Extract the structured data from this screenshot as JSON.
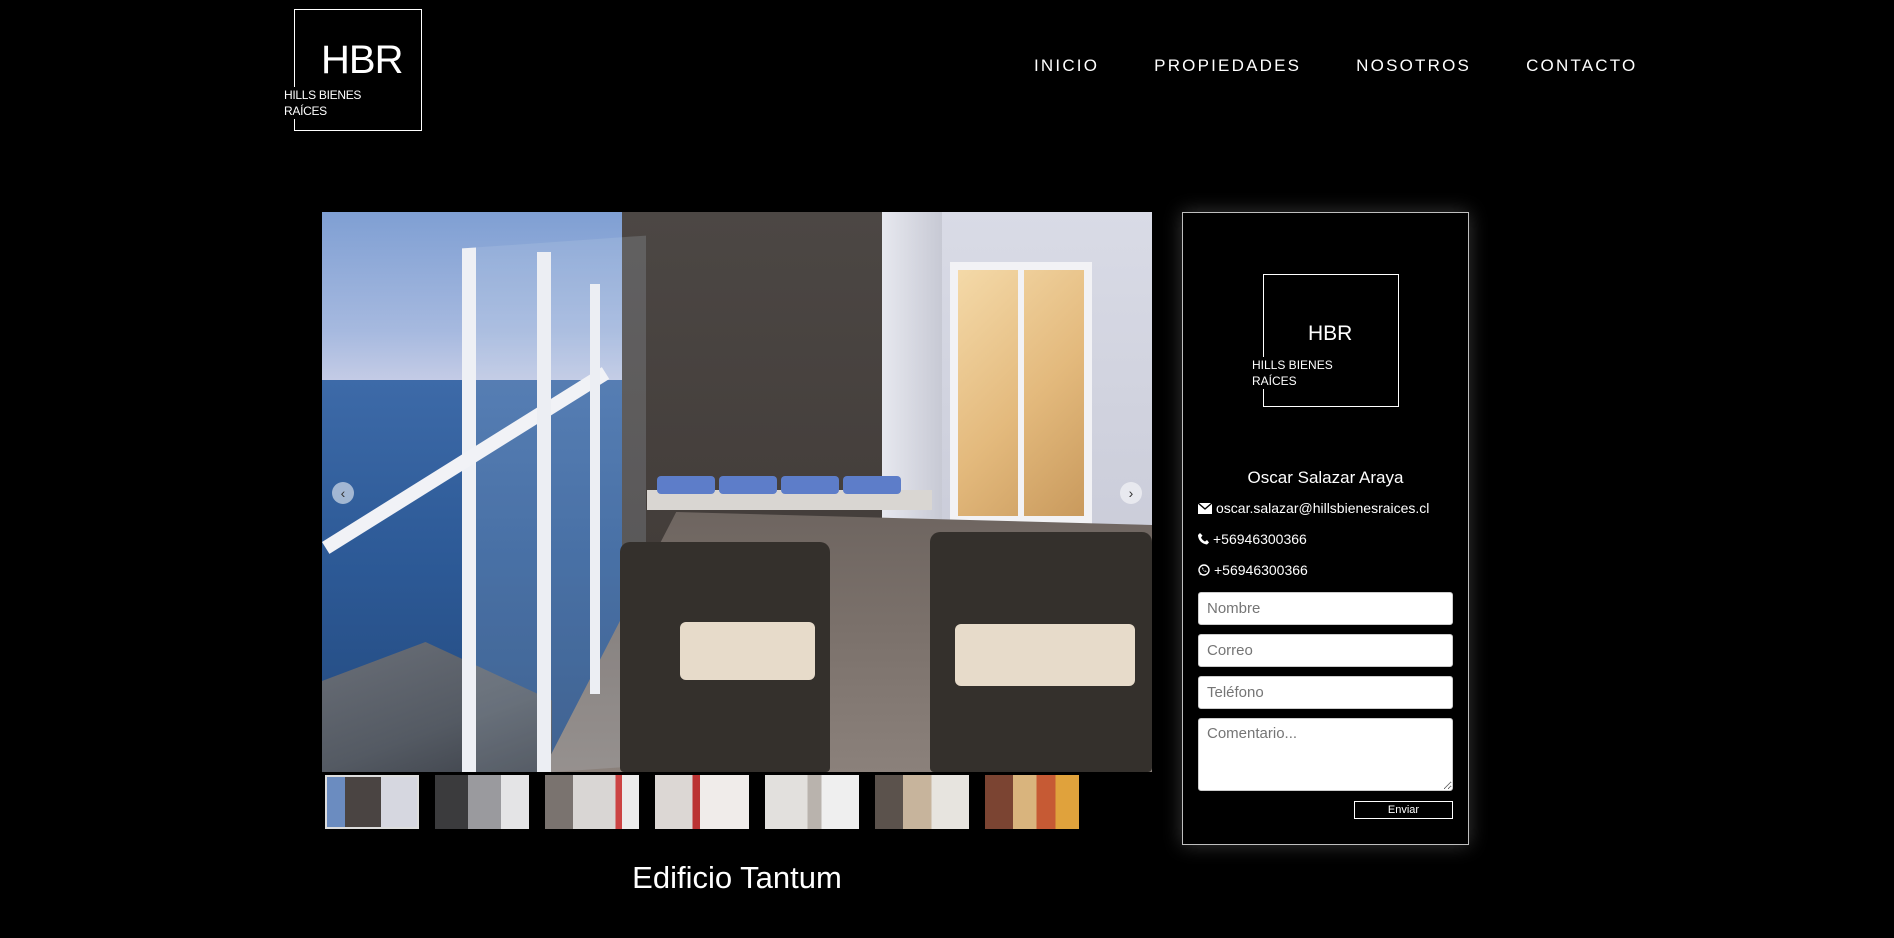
{
  "header": {
    "logo": {
      "mark": "HBR",
      "line1": "HILLS BIENES",
      "line2": "RAÍCES"
    },
    "nav": [
      {
        "label": "INICIO"
      },
      {
        "label": "PROPIEDADES"
      },
      {
        "label": "NOSOTROS"
      },
      {
        "label": "CONTACTO"
      }
    ]
  },
  "gallery": {
    "prev_icon": "chevron-left-icon",
    "next_icon": "chevron-right-icon",
    "thumbnails": [
      {
        "alt": "balcony",
        "color": "#6b7c9c"
      },
      {
        "alt": "living-room",
        "color": "#8a8a8e"
      },
      {
        "alt": "kitchen",
        "color": "#a7a2a0"
      },
      {
        "alt": "bedroom",
        "color": "#c9c2bf"
      },
      {
        "alt": "closet",
        "color": "#d3ceca"
      },
      {
        "alt": "bathroom",
        "color": "#9a8f86"
      },
      {
        "alt": "dining",
        "color": "#b75a3a"
      }
    ]
  },
  "property": {
    "title": "Edificio Tantum"
  },
  "agent": {
    "logo": {
      "mark": "HBR",
      "line1": "HILLS BIENES",
      "line2": "RAÍCES"
    },
    "name": "Oscar Salazar Araya",
    "email": "oscar.salazar@hillsbienesraices.cl",
    "phone": "+56946300366",
    "whatsapp": "+56946300366",
    "form": {
      "name_placeholder": "Nombre",
      "email_placeholder": "Correo",
      "phone_placeholder": "Teléfono",
      "comment_placeholder": "Comentario...",
      "submit_label": "Enviar"
    }
  }
}
